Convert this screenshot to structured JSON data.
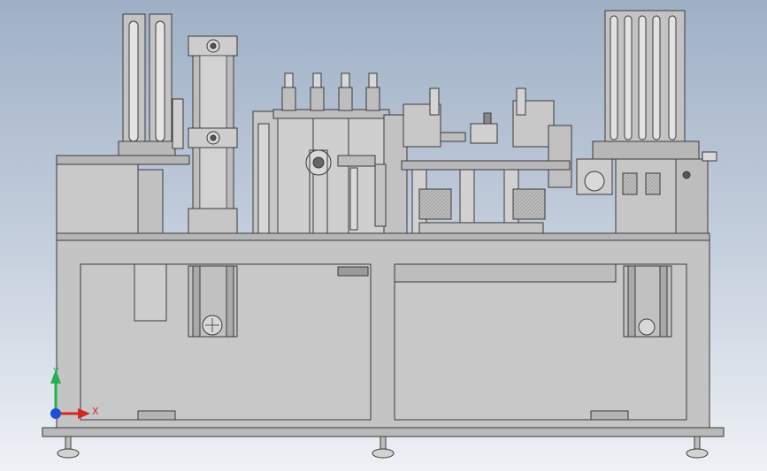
{
  "viewport": {
    "background_top": "#9fb0c6",
    "background_bottom": "#eef1f6"
  },
  "model": {
    "metal_light": "#c9c9c9",
    "metal_mid": "#b3b3b3",
    "metal_dark": "#8c8c8c",
    "edge": "#3a3a3a"
  },
  "triad": {
    "x_label": "X",
    "y_label": "Y",
    "x_color": "#d8261f",
    "y_color": "#22b14c",
    "z_color": "#1f4fd8"
  }
}
